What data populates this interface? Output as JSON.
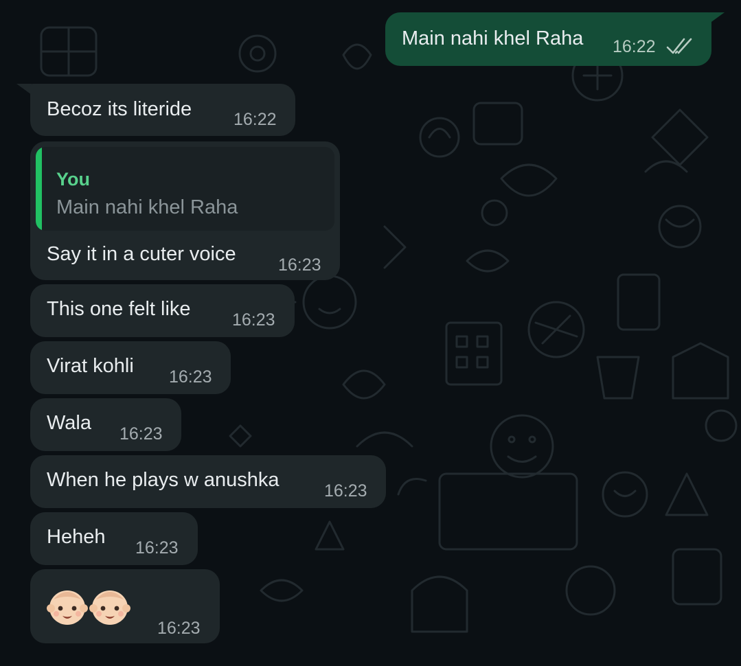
{
  "chat": {
    "outgoing": [
      {
        "text": "Main nahi khel Raha",
        "time": "16:22",
        "status_icon": "double-check-icon"
      }
    ],
    "reply": {
      "quoted_author": "You",
      "quoted_text": "Main nahi khel Raha",
      "text": "Say it in a cuter voice",
      "time": "16:23"
    },
    "incoming": [
      {
        "text": "Becoz its literide",
        "time": "16:22"
      },
      {
        "text": "This one felt like",
        "time": "16:23"
      },
      {
        "text": "Virat kohli",
        "time": "16:23"
      },
      {
        "text": "Wala",
        "time": "16:23"
      },
      {
        "text": "When he plays w anushka",
        "time": "16:23"
      },
      {
        "text": "Heheh",
        "time": "16:23"
      }
    ],
    "emoji_message": {
      "emoji": [
        "baby-face-icon",
        "baby-face-icon"
      ],
      "time": "16:23"
    }
  },
  "colors": {
    "background": "#0b1014",
    "incoming_bubble": "#1f272a",
    "outgoing_bubble": "#144d37",
    "quote_accent": "#21c063"
  }
}
